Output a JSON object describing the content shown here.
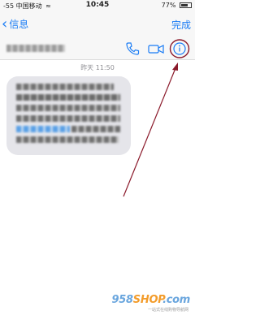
{
  "status_bar": {
    "carrier": "-55 中国移动",
    "time": "10:45",
    "battery": "77%"
  },
  "nav": {
    "back_label": "信息",
    "done_label": "完成"
  },
  "contact": {
    "actions": [
      {
        "icon": "phone-icon"
      },
      {
        "icon": "video-camera-icon"
      },
      {
        "icon": "info-icon"
      }
    ]
  },
  "conversation": {
    "timestamp": "昨天 11:50"
  },
  "colors": {
    "accent": "#1a7cf5",
    "annotation": "#8b1a2b",
    "bubble": "#e5e5ea"
  },
  "watermark": {
    "brand_num": "958",
    "brand_shop": "SHOP",
    "brand_suffix": ".com",
    "subtitle": "一站式在线购物导航网"
  }
}
